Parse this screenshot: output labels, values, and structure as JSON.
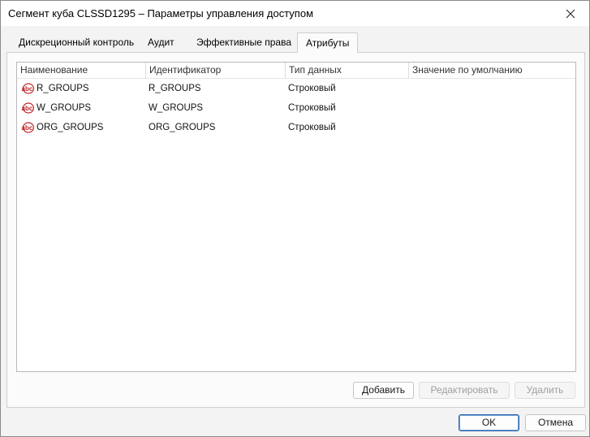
{
  "window": {
    "title": "Сегмент куба CLSSD1295 – Параметры управления доступом"
  },
  "tabs": [
    {
      "label": "Дискреционный контроль",
      "active": false
    },
    {
      "label": "Аудит",
      "active": false
    },
    {
      "label": "Эффективные права",
      "active": false
    },
    {
      "label": "Атрибуты",
      "active": true
    }
  ],
  "grid": {
    "columns": [
      "Наименование",
      "Идентификатор",
      "Тип данных",
      "Значение по умолчанию"
    ],
    "rows": [
      {
        "name": "R_GROUPS",
        "id": "R_GROUPS",
        "type": "Строковый",
        "default": "",
        "icon": "string-attribute-icon"
      },
      {
        "name": "W_GROUPS",
        "id": "W_GROUPS",
        "type": "Строковый",
        "default": "",
        "icon": "string-attribute-icon"
      },
      {
        "name": "ORG_GROUPS",
        "id": "ORG_GROUPS",
        "type": "Строковый",
        "default": "",
        "icon": "string-attribute-icon"
      }
    ]
  },
  "actions": {
    "add": "Добавить",
    "edit": "Редактировать",
    "delete": "Удалить"
  },
  "footer": {
    "ok": "OK",
    "cancel": "Отмена"
  },
  "colors": {
    "accent": "#2a63a8",
    "icon_red": "#c0282d"
  }
}
